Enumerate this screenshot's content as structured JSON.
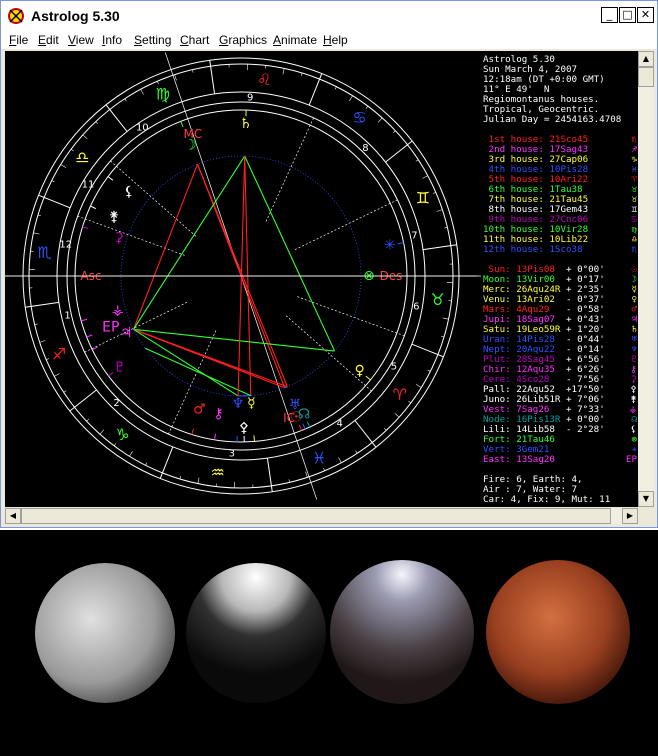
{
  "window": {
    "title": "Astrolog 5.30",
    "minimize_glyph": "_",
    "maximize_glyph": "□",
    "close_glyph": "✕"
  },
  "menu": [
    {
      "label": "File",
      "accel": "F",
      "rest": "ile"
    },
    {
      "label": "Edit",
      "accel": "E",
      "rest": "dit"
    },
    {
      "label": "View",
      "accel": "V",
      "rest": "iew"
    },
    {
      "label": "Info",
      "accel": "I",
      "rest": "nfo"
    },
    {
      "label": "Setting",
      "accel": "S",
      "rest": "etting"
    },
    {
      "label": "Chart",
      "accel": "C",
      "rest": "hart"
    },
    {
      "label": "Graphics",
      "accel": "G",
      "rest": "raphics"
    },
    {
      "label": "Animate",
      "accel": "A",
      "rest": "nimate"
    },
    {
      "label": "Help",
      "accel": "H",
      "rest": "elp"
    }
  ],
  "chart_header": [
    "Astrolog 5.30",
    "Sun March 4, 2007",
    "12:18am (DT +0:00 GMT)",
    "11° E 49'  N",
    "Regiomontanus houses.",
    "Tropical, Geocentric.",
    "Julian Day = 2454163.4708"
  ],
  "houses": [
    {
      "label": "1st house:",
      "value": "21Sco45",
      "glyph": "♏",
      "color": "#ff2020"
    },
    {
      "label": "2nd house:",
      "value": "17Sag43",
      "glyph": "♐",
      "color": "#ff30ff"
    },
    {
      "label": "3rd house:",
      "value": "27Cap06",
      "glyph": "♑",
      "color": "#ffff30"
    },
    {
      "label": "4th house:",
      "value": "10Pis28",
      "glyph": "♓",
      "color": "#3050ff"
    },
    {
      "label": "5th house:",
      "value": "10Ari22",
      "glyph": "♈",
      "color": "#ff2020"
    },
    {
      "label": "6th house:",
      "value": "1Tau38",
      "glyph": "♉",
      "color": "#30ff30"
    },
    {
      "label": "7th house:",
      "value": "21Tau45",
      "glyph": "♉",
      "color": "#ffff30"
    },
    {
      "label": "8th house:",
      "value": "17Gem43",
      "glyph": "♊",
      "color": "#ffffff"
    },
    {
      "label": "9th house:",
      "value": "27Cnc06",
      "glyph": "♋",
      "color": "#c000c0"
    },
    {
      "label": "10th house:",
      "value": "10Vir28",
      "glyph": "♍",
      "color": "#30ff30"
    },
    {
      "label": "11th house:",
      "value": "10Lib22",
      "glyph": "♎",
      "color": "#ffff30"
    },
    {
      "label": "12th house:",
      "value": "1Sco38",
      "glyph": "♏",
      "color": "#3050ff"
    }
  ],
  "planets": [
    {
      "name": "Sun:",
      "pos": "13Pis08",
      "rate": "+ 0°00'",
      "glyph": "☉",
      "color": "#ff2020"
    },
    {
      "name": "Moon:",
      "pos": "13Vir00",
      "rate": "+ 0°17'",
      "glyph": "☽",
      "color": "#30ff30"
    },
    {
      "name": "Merc:",
      "pos": "26Aqu24R",
      "rate": "+ 2°35'",
      "glyph": "☿",
      "color": "#ffff30"
    },
    {
      "name": "Venu:",
      "pos": "13Ari02",
      "rate": "- 0°37'",
      "glyph": "♀",
      "color": "#ffff30"
    },
    {
      "name": "Mars:",
      "pos": "4Aqu29",
      "rate": "- 0°58'",
      "glyph": "♂",
      "color": "#ff2020"
    },
    {
      "name": "Jupi:",
      "pos": "18Sag07",
      "rate": "+ 0°43'",
      "glyph": "♃",
      "color": "#ff30ff"
    },
    {
      "name": "Satu:",
      "pos": "19Leo59R",
      "rate": "+ 1°20'",
      "glyph": "♄",
      "color": "#ffff30"
    },
    {
      "name": "Uran:",
      "pos": "14Pis28",
      "rate": "- 0°44'",
      "glyph": "♅",
      "color": "#3050ff"
    },
    {
      "name": "Nept:",
      "pos": "20Aqu22",
      "rate": "- 0°14'",
      "glyph": "♆",
      "color": "#3050ff"
    },
    {
      "name": "Plut:",
      "pos": "28Sag45",
      "rate": "+ 6°56'",
      "glyph": "♇",
      "color": "#c000c0"
    },
    {
      "name": "Chir:",
      "pos": "12Aqu35",
      "rate": "+ 6°26'",
      "glyph": "⚷",
      "color": "#ff30ff"
    },
    {
      "name": "Cere:",
      "pos": "4Sco28",
      "rate": "- 7°56'",
      "glyph": "⚳",
      "color": "#c000c0"
    },
    {
      "name": "Pall:",
      "pos": "22Aqu52",
      "rate": "+17°50'",
      "glyph": "⚴",
      "color": "#ffffff"
    },
    {
      "name": "Juno:",
      "pos": "26Lib51R",
      "rate": "+ 7°06'",
      "glyph": "⚵",
      "color": "#ffffff"
    },
    {
      "name": "Vest:",
      "pos": "7Sag26",
      "rate": "+ 7°33'",
      "glyph": "⚶",
      "color": "#ff30ff"
    },
    {
      "name": "Node:",
      "pos": "16Pis13R",
      "rate": "+ 0°00'",
      "glyph": "☊",
      "color": "#00a0a0"
    },
    {
      "name": "Lili:",
      "pos": "14Lib58",
      "rate": "- 2°28'",
      "glyph": "⚸",
      "color": "#ffffff"
    },
    {
      "name": "Fort:",
      "pos": "21Tau46",
      "rate": "",
      "glyph": "⊗",
      "color": "#30ff30"
    },
    {
      "name": "Vert:",
      "pos": "3Gem21",
      "rate": "",
      "glyph": "✳",
      "color": "#3050ff"
    },
    {
      "name": "East:",
      "pos": "13Sag20",
      "rate": "",
      "glyph": "EP",
      "color": "#ff30ff"
    }
  ],
  "element_summary": [
    "Fire: 6, Earth: 4,",
    "Air : 7, Water: 7",
    "Car: 4, Fix: 9, Mut: 11"
  ],
  "wheel": {
    "house_numbers": [
      "1",
      "2",
      "3",
      "4",
      "5",
      "6",
      "7",
      "8",
      "9",
      "10",
      "11",
      "12"
    ],
    "angle_labels": {
      "asc": "Asc",
      "dsc": "Des",
      "mc": "MC",
      "ic": "IC"
    },
    "sign_glyphs": [
      "♈",
      "♉",
      "♊",
      "♋",
      "♌",
      "♍",
      "♎",
      "♏",
      "♐",
      "♑",
      "♒",
      "♓"
    ],
    "colors": {
      "ring": "#ffffff",
      "fire": "#ff2020",
      "earth": "#30ff30",
      "air": "#ffff30",
      "water": "#3050ff",
      "aspect_red": "#ff2020",
      "aspect_green": "#30ff30",
      "aspect_blue": "#3050ff"
    }
  },
  "scroll_arrows": {
    "up": "▲",
    "down": "▼",
    "left": "◀",
    "right": "▶"
  }
}
